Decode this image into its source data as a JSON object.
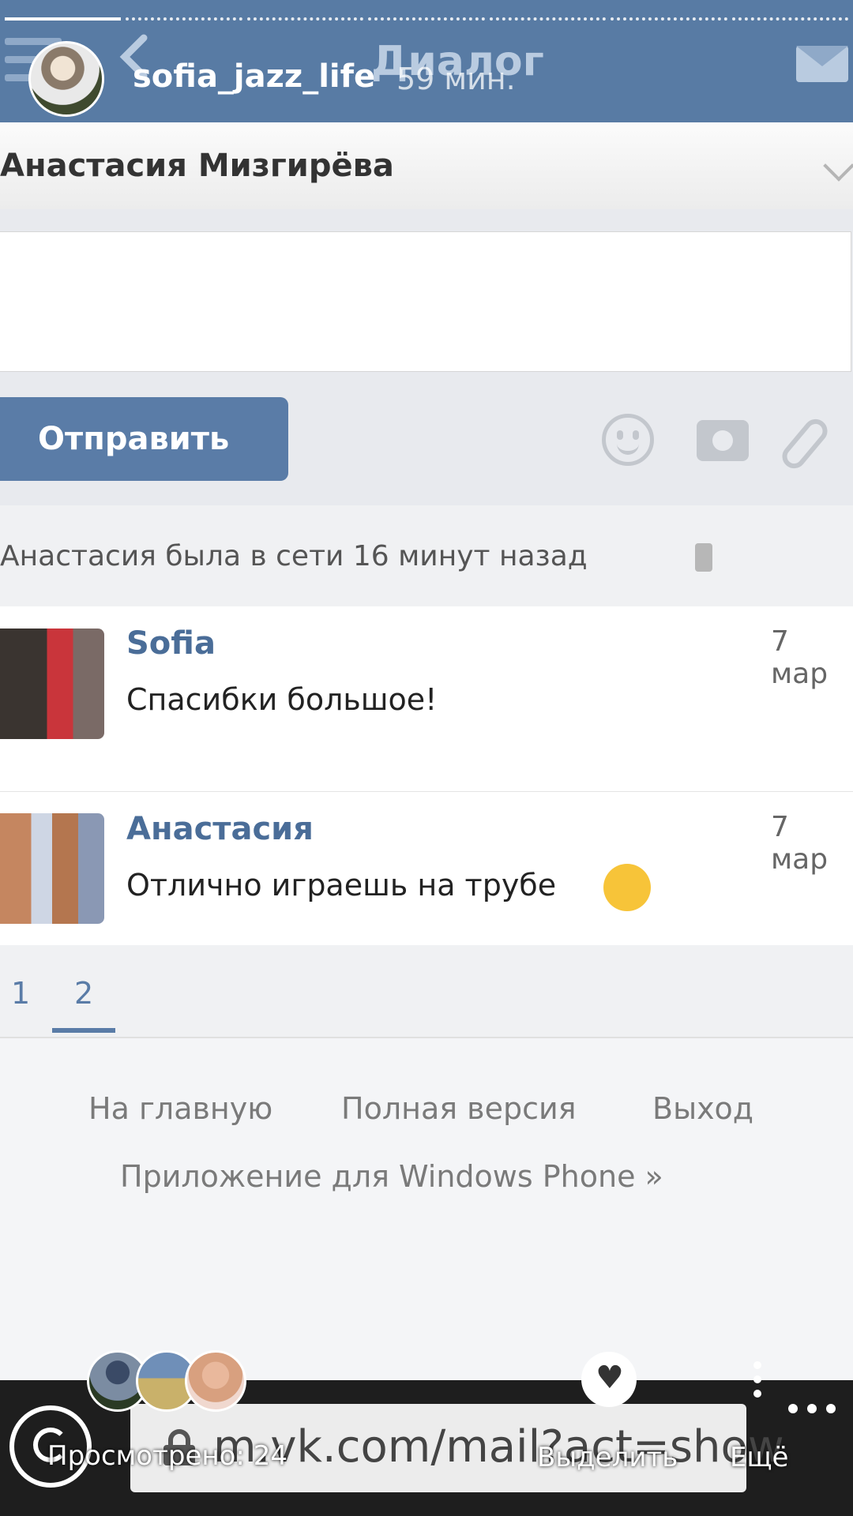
{
  "story": {
    "username": "sofia_jazz_life",
    "time": "59 мин.",
    "views": "Просмотрено: 24",
    "highlight": "Выделить",
    "more": "Ещё"
  },
  "vk": {
    "header_title": "Диалог",
    "recipient": "Анастасия Мизгирёва",
    "send_label": "Отправить",
    "status": "Анастасия была в сети 16 минут назад",
    "messages": [
      {
        "author": "Sofia",
        "date": "7 мар",
        "text": "Спасибки большое!"
      },
      {
        "author": "Анастасия",
        "date": "7 мар",
        "text": "Отлично играешь на трубе"
      }
    ],
    "pages": [
      "1",
      "2"
    ],
    "footer": {
      "home": "На главную",
      "full": "Полная версия",
      "logout": "Выход",
      "app": "Приложение для Windows Phone »"
    },
    "url": "m.vk.com/mail?act=show"
  },
  "colors": {
    "vk_blue": "#587ba4",
    "link_blue": "#4a6d98"
  }
}
